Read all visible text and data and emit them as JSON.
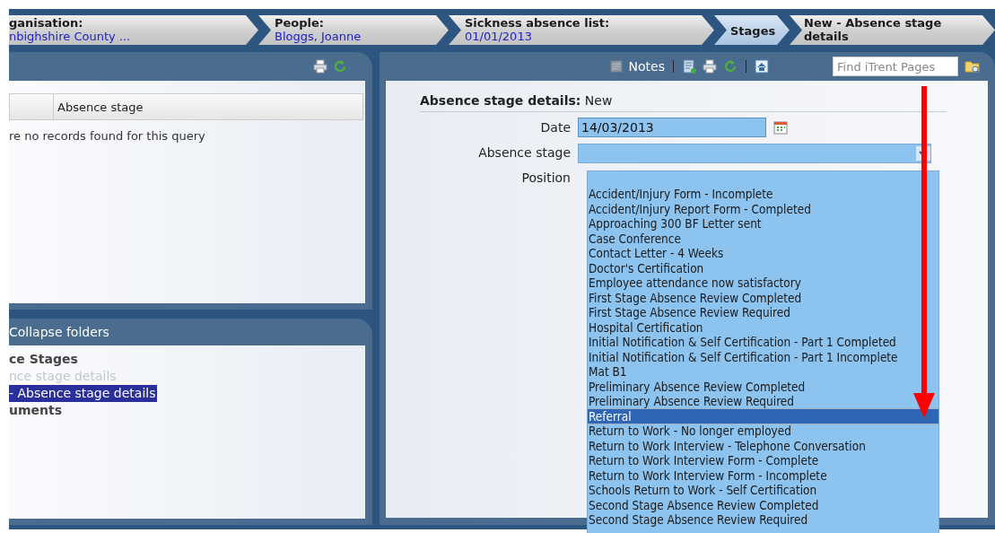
{
  "breadcrumbs": [
    {
      "label": "ganisation:",
      "value": "nbighshire County ...",
      "selected": false
    },
    {
      "label": "People:",
      "value": "Bloggs, Joanne",
      "selected": false
    },
    {
      "label": "Sickness absence list:",
      "value": "01/01/2013",
      "selected": false
    },
    {
      "label": "Stages",
      "selected": true
    },
    {
      "label": "New - Absence stage details",
      "selected": false
    }
  ],
  "list_panel": {
    "columns": [
      "Absence stage"
    ],
    "empty_message": "re no records found for this query"
  },
  "tree_panel": {
    "collapse_link": "Collapse folders",
    "items": [
      {
        "label": "ce Stages",
        "kind": "folder",
        "children": [
          {
            "label": "nce stage details",
            "disabled": true,
            "selected": false
          },
          {
            "label": "- Absence stage details",
            "disabled": false,
            "selected": true
          }
        ]
      },
      {
        "label": "uments",
        "kind": "folder"
      }
    ]
  },
  "toolbar": {
    "notes": "Notes",
    "search": {
      "placeholder": "Find iTrent Pages"
    }
  },
  "form": {
    "heading": "Absence stage details:",
    "heading_value": "New",
    "fields": [
      {
        "label": "Date",
        "value": "14/03/2013",
        "kind": "date"
      },
      {
        "label": "Absence stage",
        "kind": "select"
      },
      {
        "label": "Position",
        "kind": "none"
      }
    ],
    "options": [
      {
        "label": "Accident/Injury Form - Incomplete",
        "selected": false
      },
      {
        "label": "Accident/Injury Report Form - Completed",
        "selected": false
      },
      {
        "label": "Approaching 300 BF Letter sent",
        "selected": false
      },
      {
        "label": "Case Conference",
        "selected": false
      },
      {
        "label": "Contact Letter - 4 Weeks",
        "selected": false
      },
      {
        "label": "Doctor's Certification",
        "selected": false
      },
      {
        "label": "Employee attendance now satisfactory",
        "selected": false
      },
      {
        "label": "First Stage Absence Review Completed",
        "selected": false
      },
      {
        "label": "First Stage Absence Review Required",
        "selected": false
      },
      {
        "label": "Hospital Certification",
        "selected": false
      },
      {
        "label": "Initial Notification & Self Certification - Part 1 Completed",
        "selected": false
      },
      {
        "label": "Initial Notification & Self Certification - Part 1 Incomplete",
        "selected": false
      },
      {
        "label": "Mat B1",
        "selected": false
      },
      {
        "label": "Preliminary Absence Review Completed",
        "selected": false
      },
      {
        "label": "Preliminary Absence Review Required",
        "selected": false
      },
      {
        "label": "Referral",
        "selected": true
      },
      {
        "label": "Return to Work - No longer employed",
        "selected": false
      },
      {
        "label": "Return to Work Interview - Telephone Conversation",
        "selected": false
      },
      {
        "label": "Return to Work Interview Form - Complete",
        "selected": false
      },
      {
        "label": "Return to Work Interview Form - Incomplete",
        "selected": false
      },
      {
        "label": "Schools Return to Work - Self Certification",
        "selected": false
      },
      {
        "label": "Second Stage Absence Review Completed",
        "selected": false
      },
      {
        "label": "Second Stage Absence Review Required",
        "selected": false
      }
    ]
  }
}
